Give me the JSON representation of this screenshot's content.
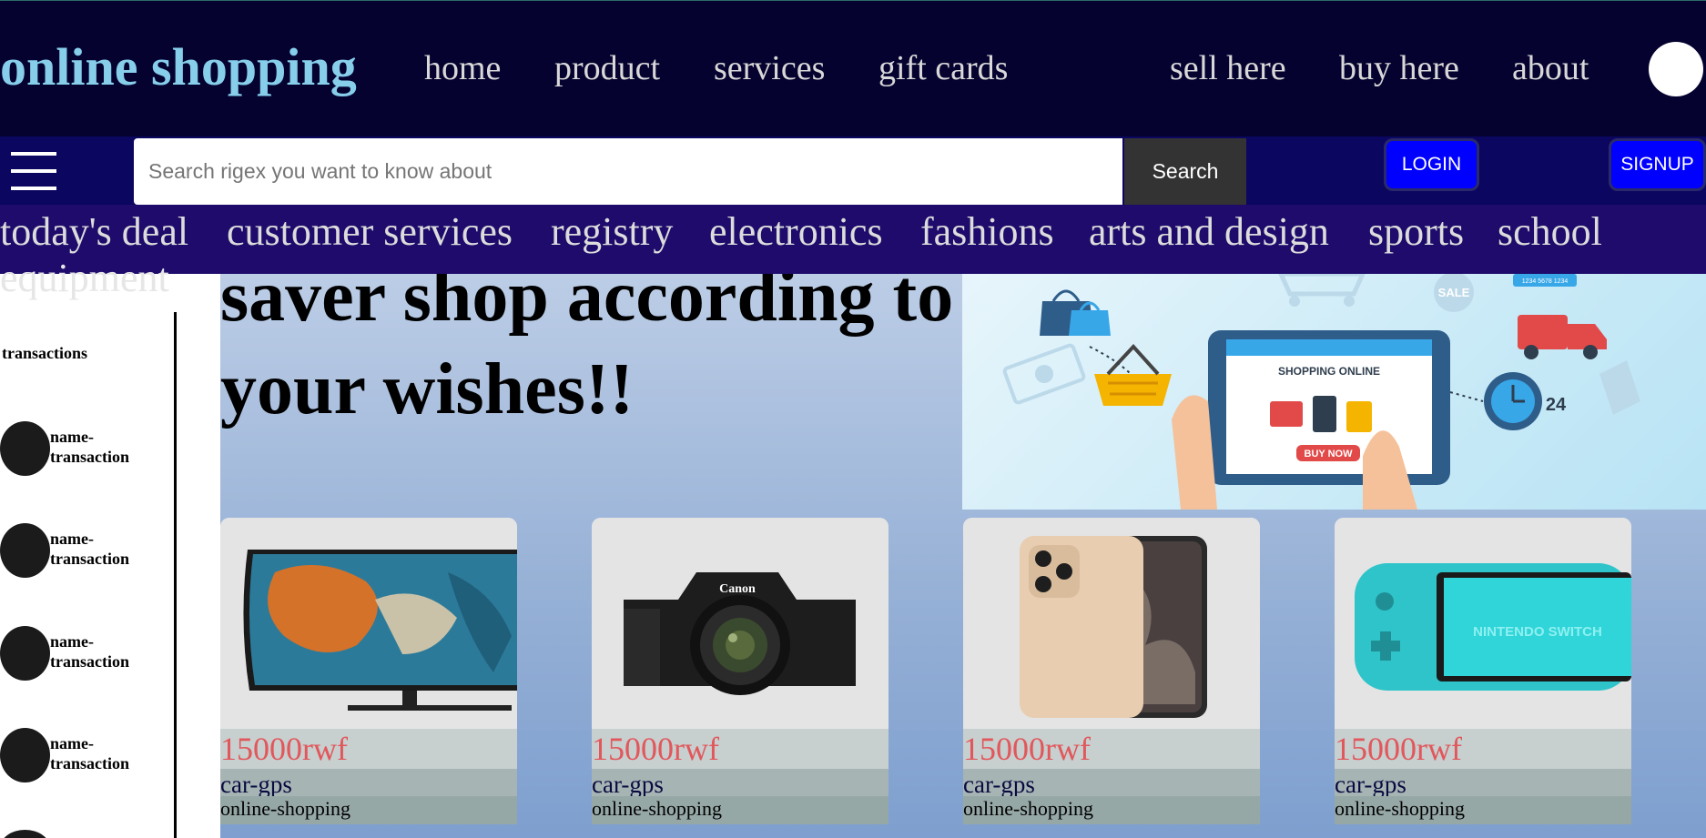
{
  "header": {
    "brand": "online shopping",
    "nav_left": [
      "home",
      "product",
      "services",
      "gift cards"
    ],
    "nav_right": [
      "sell here",
      "buy here",
      "about"
    ]
  },
  "search": {
    "placeholder": "Search rigex you want to know about",
    "button_label": "Search",
    "login_label": "LOGIN",
    "signup_label": "SIGNUP"
  },
  "categories": {
    "items": [
      "today's deal",
      "customer services",
      "registry",
      "electronics",
      "fashions",
      "arts and design",
      "sports",
      "school"
    ],
    "wrapped": "equipment"
  },
  "sidebar": {
    "title": "transactions",
    "items": [
      {
        "label": "name-transaction"
      },
      {
        "label": "name-transaction"
      },
      {
        "label": "name-transaction"
      },
      {
        "label": "name-transaction"
      }
    ]
  },
  "hero": {
    "text": "saver shop according to your wishes!!",
    "image_labels": {
      "screen_title": "SHOPPING ONLINE",
      "buy_button": "BUY NOW",
      "sale_tag": "SALE",
      "clock_number": "24",
      "card_number": "1234 5678 1234"
    }
  },
  "products": [
    {
      "price": "15000rwf",
      "name": "car-gps",
      "store": "online-shopping",
      "image": "tv-image"
    },
    {
      "price": "15000rwf",
      "name": "car-gps",
      "store": "online-shopping",
      "image": "camera-image"
    },
    {
      "price": "15000rwf",
      "name": "car-gps",
      "store": "online-shopping",
      "image": "phone-image"
    },
    {
      "price": "15000rwf",
      "name": "car-gps",
      "store": "online-shopping",
      "image": "game-console-image"
    }
  ],
  "image_texts": {
    "camera_brand": "Canon",
    "console_brand": "NINTENDO SWITCH"
  },
  "colors": {
    "topbar": "#050230",
    "searchbar": "#0b0660",
    "catbar": "#1e0b6b",
    "brand": "#87ceeb",
    "price": "#e2575b",
    "auth_button": "#0000ff"
  }
}
